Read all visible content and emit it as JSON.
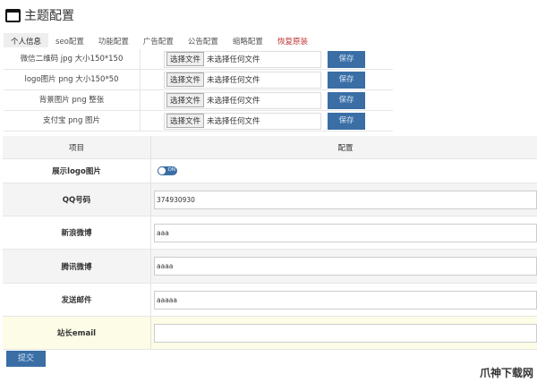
{
  "title": "主题配置",
  "tabs": [
    "个人信息",
    "seo配置",
    "功能配置",
    "广告配置",
    "公告配置",
    "缩略配置",
    "恢复原装"
  ],
  "uploads": [
    {
      "label": "微信二维码 jpg 大小150*150",
      "button": "选择文件",
      "status": "未选择任何文件",
      "save": "保存"
    },
    {
      "label": "logo图片 png 大小150*50",
      "button": "选择文件",
      "status": "未选择任何文件",
      "save": "保存"
    },
    {
      "label": "背景图片 png 整张",
      "button": "选择文件",
      "status": "未选择任何文件",
      "save": "保存"
    },
    {
      "label": "支付宝 png 图片",
      "button": "选择文件",
      "status": "未选择任何文件",
      "save": "保存"
    }
  ],
  "table": {
    "headers": [
      "项目",
      "配置"
    ],
    "logo_label": "展示logo图片",
    "toggle": "ON",
    "fields": [
      {
        "label": "QQ号码",
        "value": "374930930"
      },
      {
        "label": "新浪微博",
        "value": "aaa"
      },
      {
        "label": "腾讯微博",
        "value": "aaaa"
      },
      {
        "label": "发送邮件",
        "value": "aaaaa"
      },
      {
        "label": "站长email",
        "value": ""
      }
    ]
  },
  "submit": "提交",
  "watermark": "爪神下载网"
}
